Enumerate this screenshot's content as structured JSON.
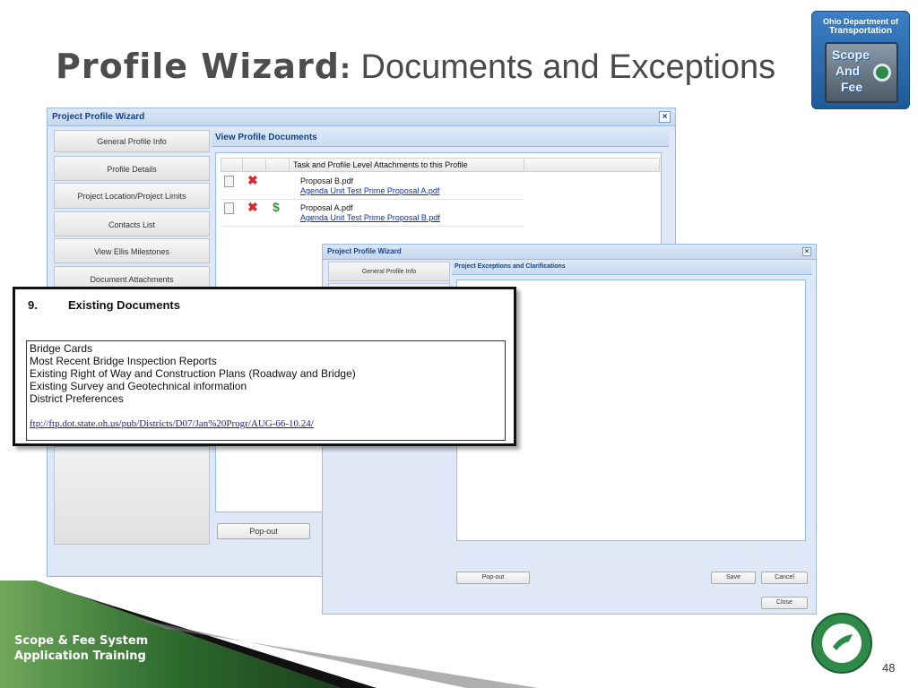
{
  "slide": {
    "title_strong": "Profile Wizard",
    "title_colon": ":",
    "title_rest": " Documents and Exceptions",
    "footer_line1": "Scope & Fee System",
    "footer_line2": "Application Training",
    "page_number": "48"
  },
  "logo": {
    "line1": "Ohio Department of",
    "line2": "Transportation",
    "word1": "Scope",
    "word2": "And",
    "word3": "Fee"
  },
  "main_window": {
    "title": "Project Profile Wizard",
    "close_glyph": "×",
    "nav": [
      "General Profile Info",
      "Profile Details",
      "Project Location/Project Limits",
      "Contacts List",
      "View Ellis Milestones",
      "Document Attachments"
    ],
    "panel_title": "View Profile Documents",
    "grid_header": "Task and Profile Level Attachments to this Profile",
    "rows": [
      {
        "name": "Proposal B.pdf",
        "link": "Agenda Unit Test Prime Proposal A.pdf",
        "has_cost": false
      },
      {
        "name": "Proposal A.pdf",
        "link": "Agenda Unit Test Prime Proposal B.pdf",
        "has_cost": true
      }
    ],
    "popout": "Pop-out"
  },
  "second_window": {
    "title": "Project Profile Wizard",
    "close_glyph": "×",
    "nav_first": "General Profile Info",
    "panel_title": "Project Exceptions and Clarifications",
    "popout": "Pop-out",
    "save": "Save",
    "cancel": "Cancel",
    "close": "Close"
  },
  "existing_docs": {
    "number": "9.",
    "heading": "Existing Documents",
    "items": [
      "Bridge Cards",
      "Most Recent Bridge Inspection Reports",
      "Existing Right of Way and Construction Plans (Roadway and Bridge)",
      "Existing Survey and Geotechnical information",
      "District Preferences"
    ],
    "ftp_link": "ftp://ftp.dot.state.oh.us/pub/Districts/D07/Jan%20Progr/AUG-66-10.24/"
  },
  "icons": {
    "doc": "document-icon",
    "delete": "delete-icon",
    "cost": "dollar-icon"
  },
  "colors": {
    "ext_blue": "#15428b",
    "delete_red": "#d42b2b",
    "cost_green": "#2f9a2f",
    "footer_green": "#2e6b2e"
  }
}
